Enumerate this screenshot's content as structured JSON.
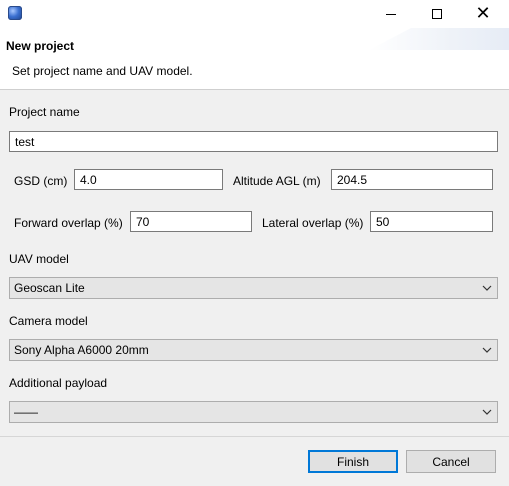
{
  "window": {
    "icon": "app-globe-icon",
    "controls": {
      "minimize": "minimize-icon",
      "maximize": "maximize-icon",
      "close": "close-icon"
    }
  },
  "header": {
    "title": "New project",
    "description": "Set project name and UAV model."
  },
  "form": {
    "project_name": {
      "label": "Project name",
      "value": "test"
    },
    "gsd": {
      "label": "GSD (cm)",
      "value": "4.0"
    },
    "altitude": {
      "label": "Altitude AGL (m)",
      "value": "204.5"
    },
    "forward_overlap": {
      "label": "Forward overlap (%)",
      "value": "70"
    },
    "lateral_overlap": {
      "label": "Lateral overlap (%)",
      "value": "50"
    },
    "uav_model": {
      "label": "UAV model",
      "value": "Geoscan Lite"
    },
    "camera_model": {
      "label": "Camera model",
      "value": "Sony Alpha A6000 20mm"
    },
    "additional_payload": {
      "label": "Additional payload",
      "value": "——"
    }
  },
  "buttons": {
    "finish": "Finish",
    "cancel": "Cancel"
  },
  "colors": {
    "accent_border": "#0078d7",
    "background": "#f0f0f0",
    "header_background": "#ffffff"
  }
}
